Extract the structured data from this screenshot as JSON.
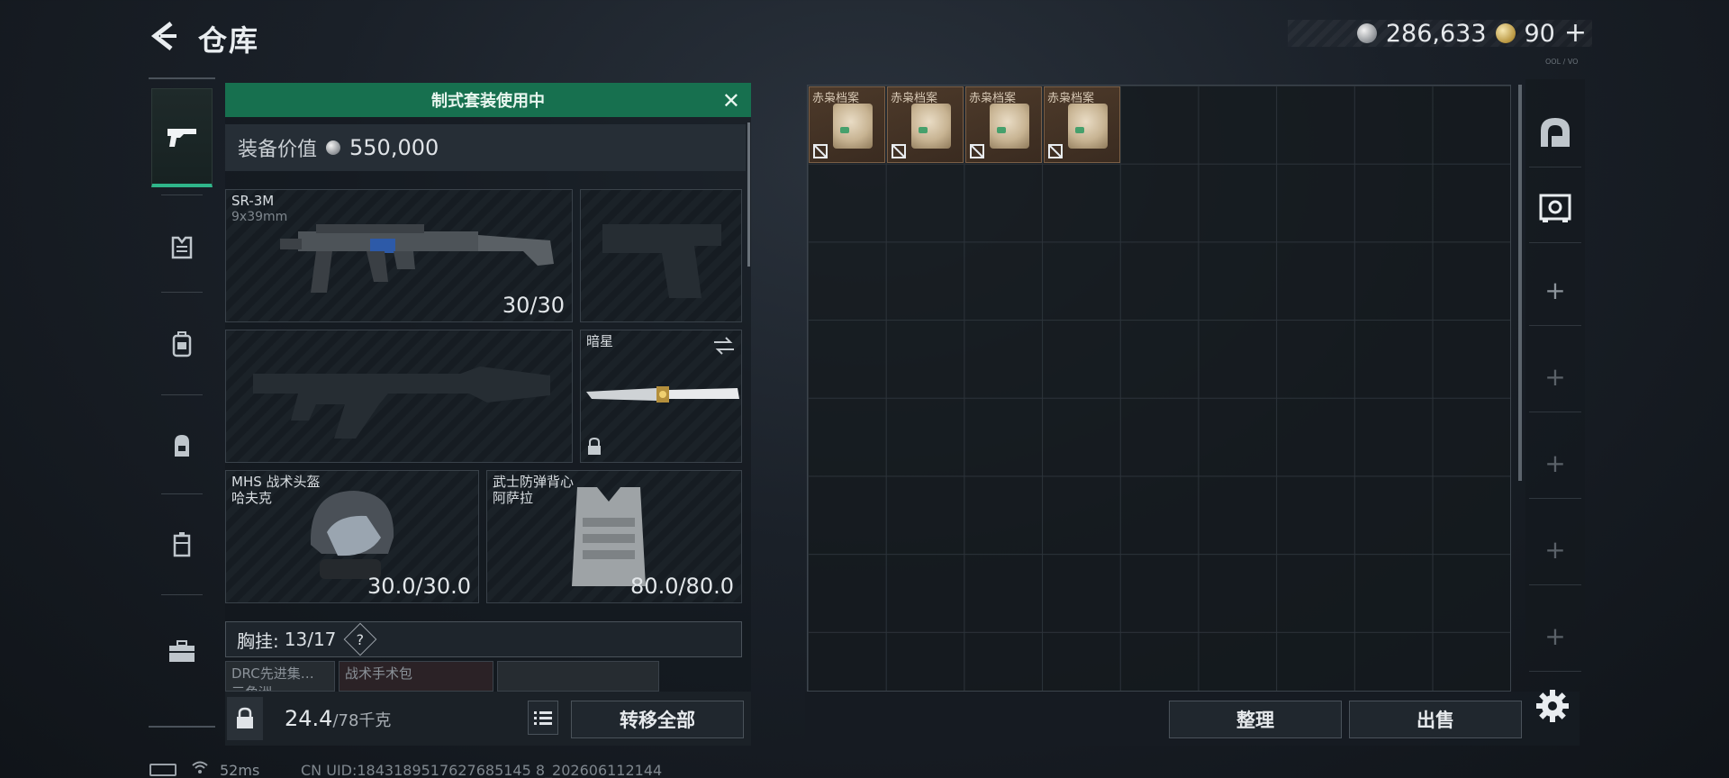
{
  "header": {
    "title": "仓库",
    "silver_amount": "286,633",
    "coupon_amount": "90",
    "coupon_plus": "+",
    "build_tag": "OOL / VO"
  },
  "banner": {
    "text": "制式套装使用中"
  },
  "equip_value": {
    "label": "装备价值",
    "value": "550,000"
  },
  "slots": {
    "primary": {
      "name": "SR-3M",
      "caliber": "9x39mm",
      "ammo": "30/30"
    },
    "melee": {
      "name": "暗星"
    },
    "helmet": {
      "name": "MHS 战术头盔",
      "variant": "哈夫克",
      "durability": "30.0/30.0"
    },
    "armor": {
      "name": "武士防弹背心",
      "variant": "阿萨拉",
      "durability": "80.0/80.0"
    }
  },
  "chest_rig": {
    "label": "胸挂:",
    "capacity": "13/17",
    "help": "?",
    "mini_items": [
      "DRC先进集…",
      "战术手术包"
    ],
    "mini_sub": "三角洲"
  },
  "bottom_left": {
    "weight": "24.4",
    "weight_cap": "/78千克",
    "transfer_all": "转移全部"
  },
  "stash": {
    "items": [
      {
        "label": "赤枭档案"
      },
      {
        "label": "赤枭档案"
      },
      {
        "label": "赤枭档案"
      },
      {
        "label": "赤枭档案"
      }
    ],
    "sort": "整理",
    "sell": "出售"
  },
  "right_tabs": {
    "plus": "+"
  },
  "footer": {
    "ping": "52ms",
    "uid": "CN UID:1843189517627685145 8_202606112144"
  },
  "colors": {
    "banner_green": "#17704f",
    "active_tab_accent": "#2fb68a",
    "item_border": "#7a5e45"
  },
  "icons": {
    "back": "back-chevron-icon",
    "category": [
      "gun-icon",
      "armor-vest-icon",
      "chest-rig-icon",
      "backpack-icon",
      "case-icon",
      "toolbox-icon"
    ],
    "right_tabs": [
      "arch-icon",
      "safe-icon",
      "plus-icon"
    ]
  }
}
